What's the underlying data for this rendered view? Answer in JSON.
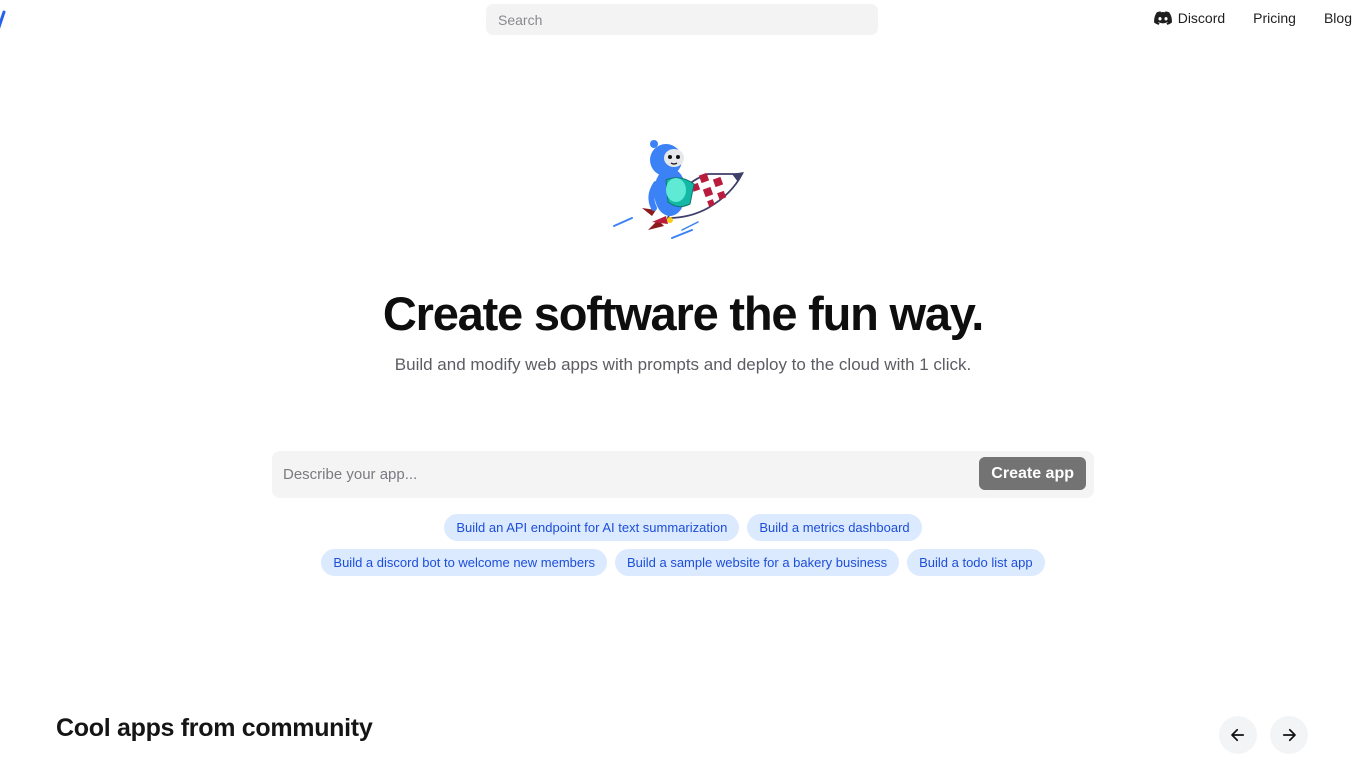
{
  "header": {
    "search_placeholder": "Search",
    "nav": {
      "discord": "Discord",
      "pricing": "Pricing",
      "blog": "Blog"
    }
  },
  "hero": {
    "title": "Create software the fun way.",
    "subtitle": "Build and modify web apps with prompts and deploy to the cloud with 1 click."
  },
  "prompt": {
    "placeholder": "Describe your app...",
    "button_label": "Create app"
  },
  "suggestions": {
    "row1": [
      "Build an API endpoint for AI text summarization",
      "Build a metrics dashboard"
    ],
    "row2": [
      "Build a discord bot to welcome new members",
      "Build a sample website for a bakery business",
      "Build a todo list app"
    ]
  },
  "community": {
    "title": "Cool apps from community"
  },
  "icons": {
    "discord": "discord-icon",
    "prev": "arrow-left-icon",
    "next": "arrow-right-icon",
    "mascot": "rocket-mascot-icon"
  },
  "colors": {
    "chip_bg": "#dbeafe",
    "chip_text": "#1d4ed8",
    "button_bg": "#737373",
    "logo": "#2563eb"
  }
}
